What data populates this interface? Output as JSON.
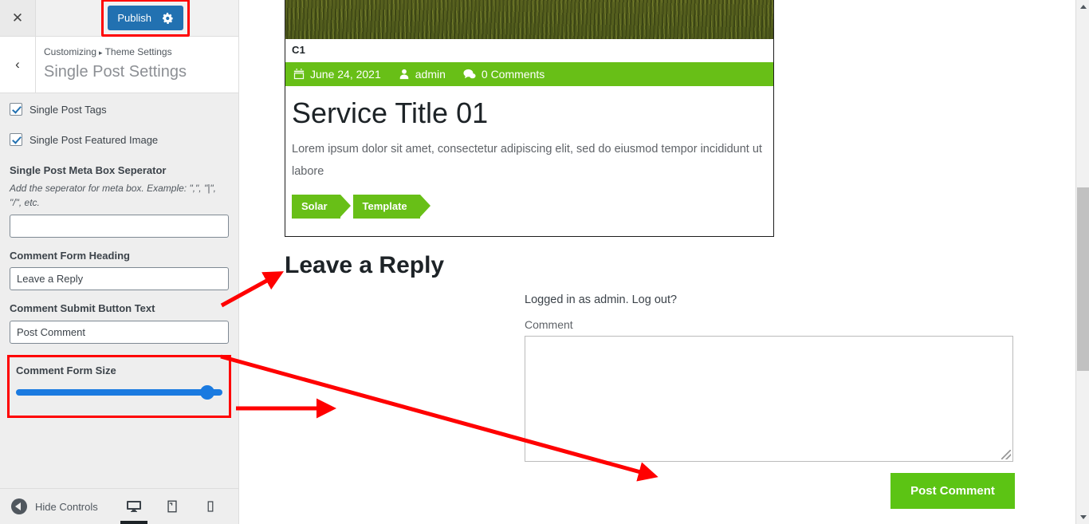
{
  "customizer": {
    "close_icon": "close-icon",
    "publish_label": "Publish",
    "publish_gear_icon": "gear-icon",
    "back_icon": "chevron-left-icon",
    "breadcrumb_root": "Customizing",
    "breadcrumb_sep": "▸",
    "breadcrumb_parent": "Theme Settings",
    "panel_title": "Single Post Settings",
    "controls": {
      "tags_checkbox_label": "Single Post Tags",
      "featured_checkbox_label": "Single Post Featured Image",
      "separator_label": "Single Post Meta Box Seperator",
      "separator_desc": "Add the seperator for meta box. Example: \",\", \"|\", \"/\", etc.",
      "separator_value": "",
      "heading_label": "Comment Form Heading",
      "heading_value": "Leave a Reply",
      "submit_label": "Comment Submit Button Text",
      "submit_value": "Post Comment",
      "size_label": "Comment Form Size",
      "size_percent": 96
    },
    "footer": {
      "hide_controls_label": "Hide Controls",
      "device_desktop_icon": "desktop-icon",
      "device_tablet_icon": "tablet-icon",
      "device_mobile_icon": "mobile-icon",
      "active_device": "desktop"
    }
  },
  "preview": {
    "image_alt": "grass-field-featured-image",
    "c1_label": "C1",
    "meta": {
      "date_icon": "calendar-icon",
      "date": "June 24, 2021",
      "author_icon": "user-icon",
      "author": "admin",
      "comments_icon": "comments-icon",
      "comments": "0 Comments"
    },
    "title": "Service Title 01",
    "excerpt": "Lorem ipsum dolor sit amet, consectetur adipiscing elit, sed do eiusmod tempor incididunt ut labore",
    "tags": [
      "Solar",
      "Template"
    ],
    "comment_form": {
      "heading": "Leave a Reply",
      "logged_in_text": "Logged in as admin. Log out?",
      "comment_label": "Comment",
      "comment_value": "",
      "submit_label": "Post Comment"
    }
  },
  "colors": {
    "brand_green": "#68bf17",
    "button_green": "#5cc414",
    "wp_blue": "#2271b1",
    "slider_blue": "#1a7ae0",
    "annotation_red": "#ff0000"
  }
}
